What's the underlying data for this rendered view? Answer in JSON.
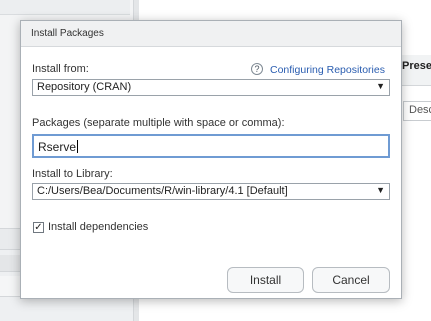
{
  "background": {
    "panel_header": "Presen",
    "column_header": "Desc"
  },
  "dialog": {
    "title": "Install Packages",
    "install_from": {
      "label": "Install from:",
      "value": "Repository (CRAN)",
      "arrow": "▼"
    },
    "help": {
      "icon": "question-mark-icon",
      "icon_glyph": "?",
      "link_text": "Configuring Repositories",
      "link_color": "#2a5db0"
    },
    "packages": {
      "label": "Packages (separate multiple with space or comma):",
      "value": "Rserve"
    },
    "library": {
      "label": "Install to Library:",
      "value": "C:/Users/Bea/Documents/R/win-library/4.1 [Default]",
      "arrow": "▼"
    },
    "dependencies": {
      "label": "Install dependencies",
      "checked": true,
      "check_glyph": "✓"
    },
    "buttons": {
      "install": "Install",
      "cancel": "Cancel"
    }
  }
}
